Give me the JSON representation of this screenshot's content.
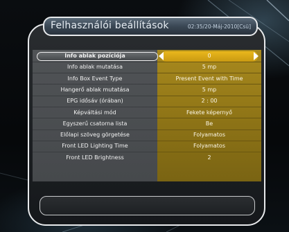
{
  "header": {
    "title": "Felhasználói beállítások",
    "datetime": "02:35/20-Máj-2010[Csü]"
  },
  "settings": {
    "selected_index": 0,
    "rows": [
      {
        "label": "Info ablak pozíciója",
        "value": "0"
      },
      {
        "label": "Info ablak mutatása",
        "value": "5 mp"
      },
      {
        "label": "Info Box Event Type",
        "value": "Present Event with Time"
      },
      {
        "label": "Hangerő ablak mutatása",
        "value": "5 mp"
      },
      {
        "label": "EPG idősáv (órában)",
        "value": "2 : 00"
      },
      {
        "label": "Képváltási mód",
        "value": "Fekete képernyő"
      },
      {
        "label": "Egyszerű csatorna lista",
        "value": "Be"
      },
      {
        "label": "Előlapi szöveg görgetése",
        "value": "Folyamatos"
      },
      {
        "label": "Front LED Lighting Time",
        "value": "Folyamatos"
      },
      {
        "label": "Front LED Brightness",
        "value": "2"
      }
    ]
  },
  "colors": {
    "value_column": "#a98a1e",
    "selected_value": "#e9b71c",
    "label_column": "#505356"
  },
  "icons": {
    "left_arrow": "arrow-left-icon",
    "right_arrow": "arrow-right-icon"
  }
}
